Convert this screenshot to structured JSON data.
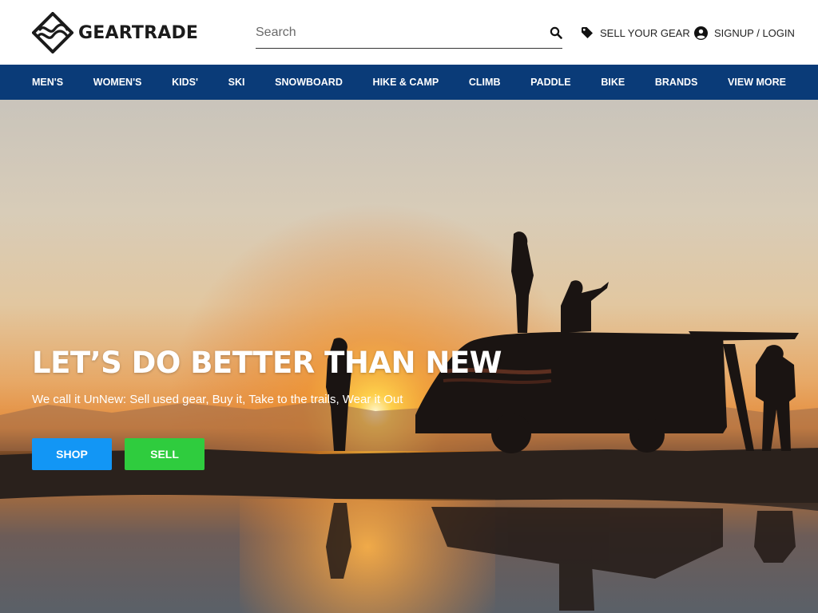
{
  "brand": {
    "name": "GEARTRADE"
  },
  "search": {
    "placeholder": "Search"
  },
  "header_links": {
    "sell": "SELL YOUR GEAR",
    "login": "SIGNUP / LOGIN"
  },
  "nav": {
    "items": [
      "MEN'S",
      "WOMEN'S",
      "KIDS'",
      "SKI",
      "SNOWBOARD",
      "HIKE & CAMP",
      "CLIMB",
      "PADDLE",
      "BIKE",
      "BRANDS",
      "VIEW MORE"
    ]
  },
  "hero": {
    "title": "LET’S DO BETTER THAN NEW",
    "subtitle": "We call it UnNew: Sell used gear, Buy it, Take to the trails, Wear it Out",
    "shop_label": "SHOP",
    "sell_label": "SELL"
  },
  "colors": {
    "nav_bg": "#0a3b78",
    "shop_button": "#1296f5",
    "sell_button": "#2fcc3e"
  },
  "icons": [
    "geartrade-logo-icon",
    "search-icon",
    "tag-icon",
    "user-circle-icon"
  ]
}
